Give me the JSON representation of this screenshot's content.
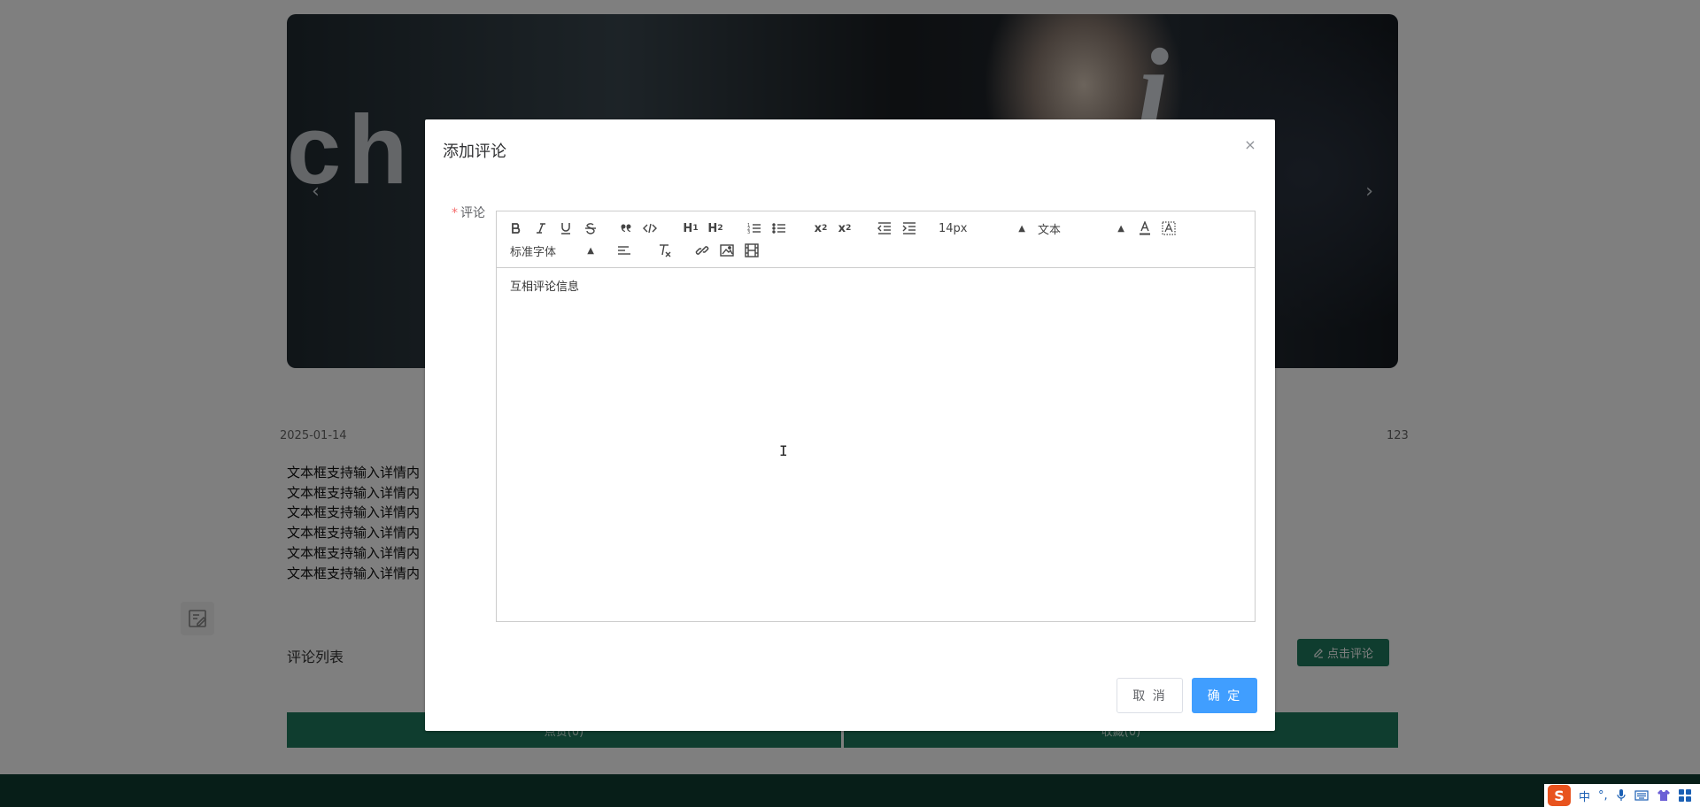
{
  "page": {
    "banner": {
      "overlay_text_left": "ch r",
      "overlay_text_right": "i",
      "prev_arrow": "‹",
      "next_arrow": "›"
    },
    "date": "2025-01-14",
    "count": "123",
    "detail_lines": [
      "文本框支持输入详情内",
      "文本框支持输入详情内",
      "文本框支持输入详情内",
      "文本框支持输入详情内",
      "文本框支持输入详情内",
      "文本框支持输入详情内"
    ],
    "comment_list_title": "评论列表",
    "click_comment_label": "点击评论",
    "like_label": "点赞(0)",
    "favorite_label": "收藏(0)"
  },
  "dialog": {
    "title": "添加评论",
    "close_glyph": "×",
    "form_label": "评论",
    "required_mark": "*",
    "editor": {
      "size_picker": "14px",
      "header_picker": "文本",
      "font_picker": "标准字体",
      "content": "互相评论信息"
    },
    "cancel_label": "取 消",
    "ok_label": "确 定"
  },
  "ime": {
    "logo": "S",
    "lang": "中",
    "punct": "°,",
    "items": [
      "mic-icon",
      "keyboard-icon",
      "skin-icon",
      "grid-icon"
    ]
  },
  "colors": {
    "primary": "#409eff",
    "theme_green": "#1f7a5e",
    "footer": "#0f3d30",
    "required": "#f56c6c"
  }
}
